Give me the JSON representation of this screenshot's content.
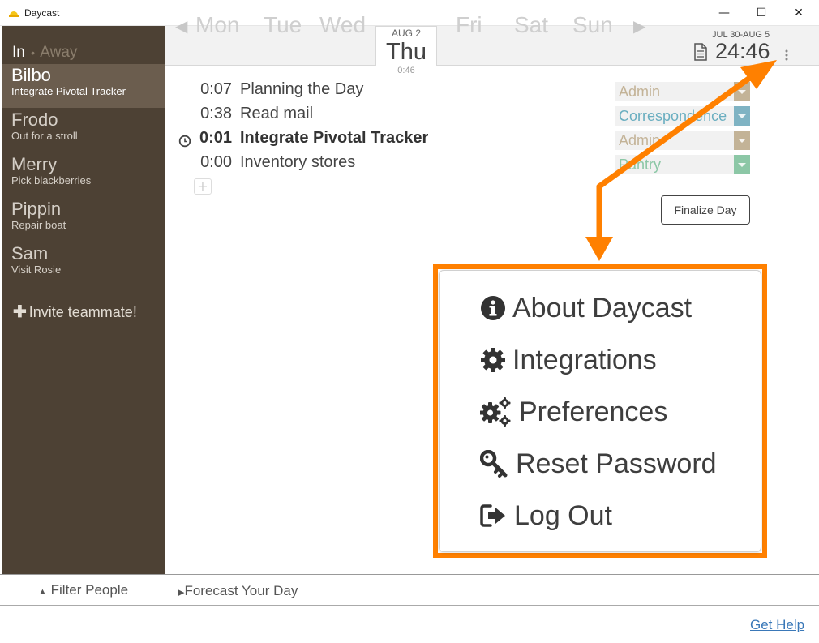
{
  "window": {
    "title": "Daycast",
    "minimize": "—",
    "maximize": "☐",
    "close": "✕"
  },
  "sidebar": {
    "status_in": "In",
    "status_separator": "•",
    "status_away": "Away",
    "people": [
      {
        "name": "Bilbo",
        "task": "Integrate Pivotal Tracker",
        "active": true
      },
      {
        "name": "Frodo",
        "task": "Out for a stroll"
      },
      {
        "name": "Merry",
        "task": "Pick blackberries"
      },
      {
        "name": "Pippin",
        "task": "Repair boat"
      },
      {
        "name": "Sam",
        "task": "Visit Rosie"
      }
    ],
    "invite_label": "Invite teammate!"
  },
  "week": {
    "days": [
      "Mon",
      "Tue",
      "Wed",
      "Thu",
      "Fri",
      "Sat",
      "Sun"
    ],
    "selected_day": "Thu",
    "selected_date": "AUG 2",
    "selected_total": "0:46",
    "range": "JUL 30-AUG 5",
    "total": "24:46"
  },
  "entries": [
    {
      "time": "0:07",
      "desc": "Planning the Day",
      "category": "Admin",
      "cat_color": "#c3b397",
      "cat_text": "#c3b397"
    },
    {
      "time": "0:38",
      "desc": "Read mail",
      "category": "Correspondence",
      "cat_color": "#7fb3c3",
      "cat_text": "#6aaec0"
    },
    {
      "time": "0:01",
      "desc": "Integrate Pivotal Tracker",
      "category": "Admin",
      "cat_color": "#c3b397",
      "cat_text": "#c3b397",
      "active": true
    },
    {
      "time": "0:00",
      "desc": "Inventory stores",
      "category": "Pantry",
      "cat_color": "#8cc7a6",
      "cat_text": "#8cc7a6"
    }
  ],
  "add_label": "+",
  "finalize_label": "Finalize Day",
  "footer": {
    "filter_label": "Filter People",
    "forecast_label": "Forecast Your Day",
    "help_label": "Get Help"
  },
  "menu": {
    "items": [
      {
        "label": "About Daycast",
        "icon": "info-icon"
      },
      {
        "label": "Integrations",
        "icon": "gear-icon"
      },
      {
        "label": "Preferences",
        "icon": "gears-icon"
      },
      {
        "label": "Reset Password",
        "icon": "key-icon"
      },
      {
        "label": "Log Out",
        "icon": "logout-icon"
      }
    ]
  },
  "colors": {
    "sidebar_bg": "#4d4134",
    "sidebar_active": "#6b5d4e",
    "highlight": "#ff8000",
    "link": "#3a78b8"
  }
}
